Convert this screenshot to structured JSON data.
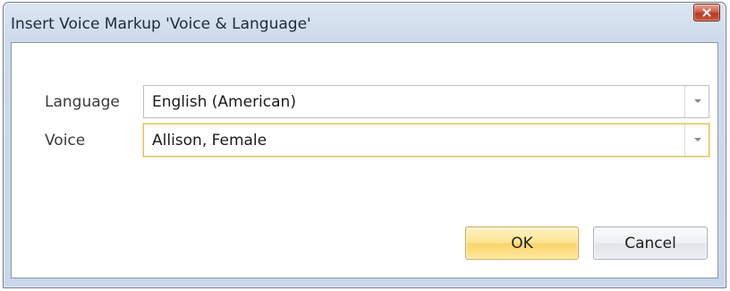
{
  "window": {
    "title": "Insert Voice Markup 'Voice & Language'"
  },
  "close_icon": "close-icon",
  "form": {
    "language": {
      "label": "Language",
      "value": "English (American)"
    },
    "voice": {
      "label": "Voice",
      "value": "Allison, Female"
    }
  },
  "buttons": {
    "ok_label": "OK",
    "cancel_label": "Cancel"
  },
  "colors": {
    "ok_accent": "#fde38f",
    "focus_border": "#e3c15c",
    "close_red": "#c9553c"
  }
}
